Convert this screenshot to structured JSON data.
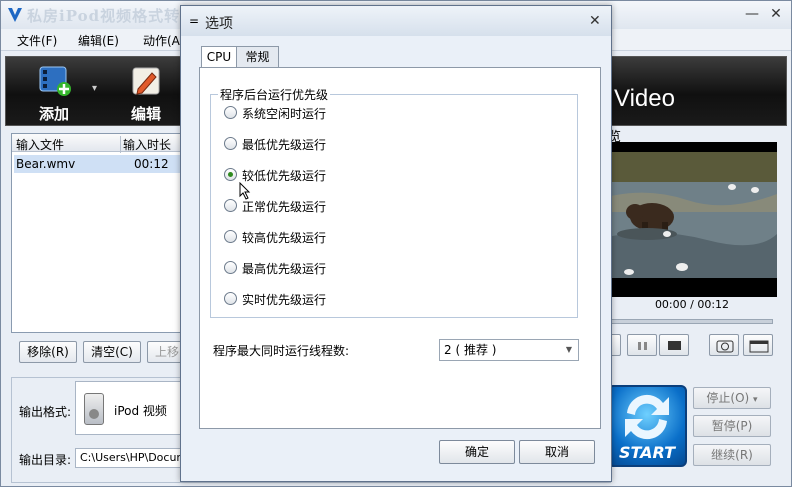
{
  "app": {
    "title": "私房iPod视频格式转换器"
  },
  "menu": [
    "文件(F)",
    "编辑(E)",
    "动作(A)"
  ],
  "toolbar": {
    "add_label": "添加",
    "edit_label": "编辑",
    "brand": "Video"
  },
  "filelist": {
    "col_file": "输入文件",
    "col_duration": "输入时长",
    "rows": [
      {
        "file": "Bear.wmv",
        "duration": "00:12"
      }
    ]
  },
  "list_buttons": {
    "remove": "移除(R)",
    "clear": "清空(C)",
    "up": "上移"
  },
  "output": {
    "format_label": "输出格式:",
    "format_value": "iPod 视频",
    "dir_label": "输出目录:",
    "dir_value": "C:\\Users\\HP\\Docume"
  },
  "preview": {
    "title": "览",
    "time": "00:00 / 00:12"
  },
  "actions": {
    "start": "START",
    "stop": "停止(O)",
    "pause": "暂停(P)",
    "resume": "继续(R)"
  },
  "dialog": {
    "title": "选项",
    "tabs": [
      "CPU",
      "常规"
    ],
    "group_title": "程序后台运行优先级",
    "priorities": [
      {
        "label": "系统空闲时运行",
        "checked": false
      },
      {
        "label": "最低优先级运行",
        "checked": false
      },
      {
        "label": "较低优先级运行",
        "checked": true
      },
      {
        "label": "正常优先级运行",
        "checked": false
      },
      {
        "label": "较高优先级运行",
        "checked": false
      },
      {
        "label": "最高优先级运行",
        "checked": false
      },
      {
        "label": "实时优先级运行",
        "checked": false
      }
    ],
    "thread_label": "程序最大同时运行线程数:",
    "thread_value": "2 ( 推荐 )",
    "ok": "确定",
    "cancel": "取消"
  },
  "colors": {
    "accent": "#0a6fc9",
    "selected_row": "#cfe0f5",
    "radio_on": "#2f8a1f"
  }
}
